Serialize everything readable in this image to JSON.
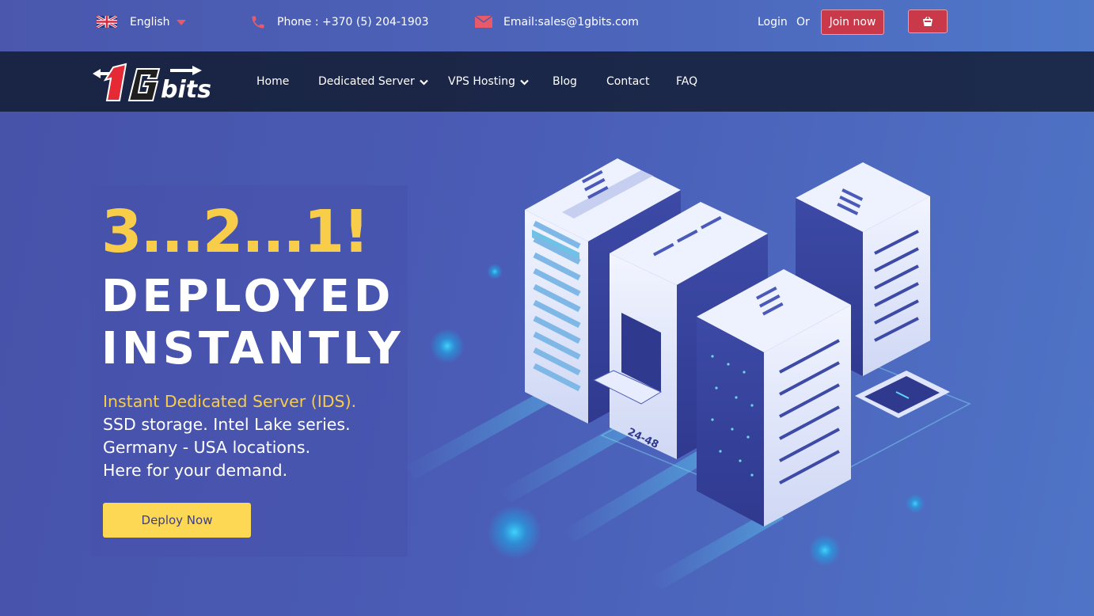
{
  "topbar": {
    "language": "English",
    "phone": "Phone : +370 (5) 204-1903",
    "email": "Email:sales@1gbits.com",
    "login": "Login",
    "or": "Or",
    "join": "Join now"
  },
  "nav": {
    "logo_text": "1Gbits",
    "items": [
      "Home",
      "Dedicated Server",
      "VPS Hosting",
      "Blog",
      "Contact",
      "FAQ"
    ]
  },
  "hero": {
    "countdown": "3...2...1!",
    "headline_1": "DEPLOYED",
    "headline_2": "INSTANTLY",
    "line_1": "Instant Dedicated Server (IDS).",
    "line_2": "SSD storage. Intel Lake series.",
    "line_3": "Germany - USA locations.",
    "line_4": "Here for your demand.",
    "cta": "Deploy Now",
    "server_badge": "24-48"
  },
  "colors": {
    "accent_yellow": "#f7cd4a",
    "button_red": "#c9394a",
    "nav_dark": "#1b2747",
    "hero_blue": "#4a5cb6"
  },
  "icons": [
    "uk-flag-icon",
    "caret-down-icon",
    "phone-icon",
    "mail-icon",
    "cart-icon",
    "chevron-down-icon"
  ]
}
